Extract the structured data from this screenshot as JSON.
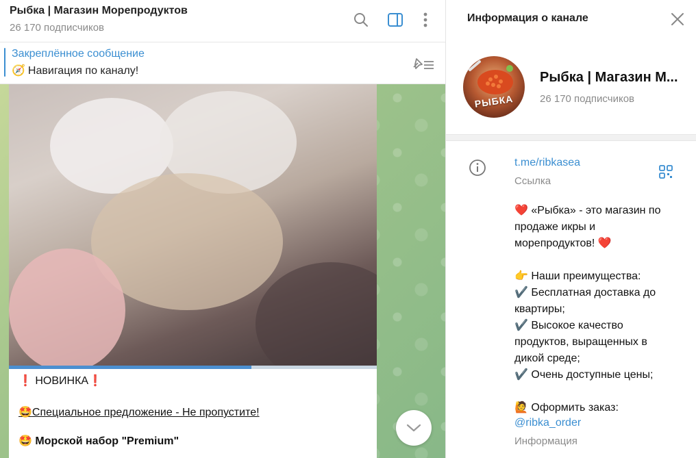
{
  "chat": {
    "title": "Рыбка | Магазин Морепродуктов",
    "subscribers": "26 170 подписчиков",
    "pinned": {
      "title": "Закреплённое сообщение",
      "emoji": "🧭",
      "text": "Навигация по каналу!"
    },
    "message": {
      "progress_fraction": 0.66,
      "caption_1": "❗ НОВИНКА❗",
      "caption_2_emoji": "🤩",
      "caption_2": "Специальное предложение - Не пропустите!",
      "caption_3_emoji": "🤩",
      "caption_3": "Морской набор \"Premium\""
    }
  },
  "info": {
    "title": "Информация о канале",
    "channel_name": "Рыбка | Магазин М...",
    "subscribers": "26 170 подписчиков",
    "avatar_text": "РЫБКА",
    "link": "t.me/ribkasea",
    "link_label": "Ссылка",
    "about_lines": [
      "❤️ «Рыбка» - это магазин по",
      "продаже икры и",
      "морепродуктов! ❤️",
      "",
      "👉 Наши преимущества:",
      "✔️ Бесплатная доставка до",
      "квартиры;",
      "✔️ Высокое качество",
      "продуктов, выращенных в",
      "дикой среде;",
      "✔️ Очень доступные цены;",
      "",
      "🙋 Оформить заказ:"
    ],
    "order_link": "@ribka_order",
    "about_label": "Информация"
  },
  "colors": {
    "accent": "#3a8ed1",
    "muted": "#8a8a8a"
  },
  "icons": [
    "search-icon",
    "sidebar-toggle-icon",
    "more-icon",
    "pinned-list-icon",
    "chevron-down-icon",
    "close-icon",
    "info-icon",
    "qr-code-icon"
  ]
}
